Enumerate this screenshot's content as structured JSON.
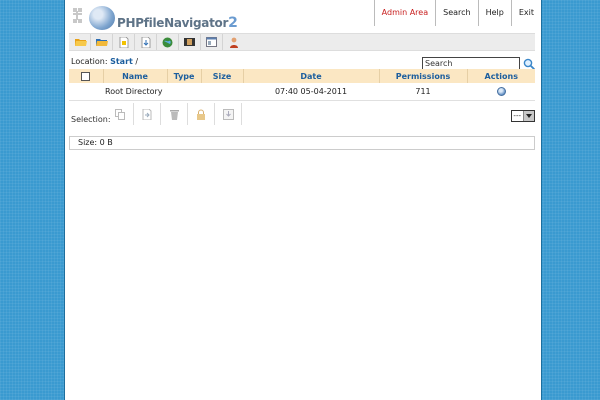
{
  "app": {
    "logo_name": "PHPfileNavigator",
    "logo_version": "2"
  },
  "topnav": [
    {
      "label": "Admin Area",
      "id": "admin"
    },
    {
      "label": "Search",
      "id": "search"
    },
    {
      "label": "Help",
      "id": "help"
    },
    {
      "label": "Exit",
      "id": "exit"
    }
  ],
  "toolbar": {
    "icons": [
      "open-folder-icon",
      "new-folder-icon",
      "new-file-icon",
      "upload-icon",
      "globe-icon",
      "film-icon",
      "window-icon",
      "user-icon"
    ]
  },
  "location": {
    "label": "Location:",
    "path_link": "Start",
    "separator": "/"
  },
  "search": {
    "placeholder": "Search"
  },
  "table": {
    "headers": {
      "name": "Name",
      "type": "Type",
      "size": "Size",
      "date": "Date",
      "permissions": "Permissions",
      "actions": "Actions"
    },
    "rows": [
      {
        "name": "Root Directory",
        "type": "",
        "size": "",
        "date": "07:40 05-04-2011",
        "permissions": "711"
      }
    ]
  },
  "selection": {
    "label": "Selection:",
    "dropdown_value": "---"
  },
  "status": {
    "size_text": "Size: 0 B"
  },
  "colors": {
    "background": "#3a9ad0",
    "header_row": "#fbe7c3",
    "link": "#1c5e9e",
    "admin": "#c82020"
  }
}
